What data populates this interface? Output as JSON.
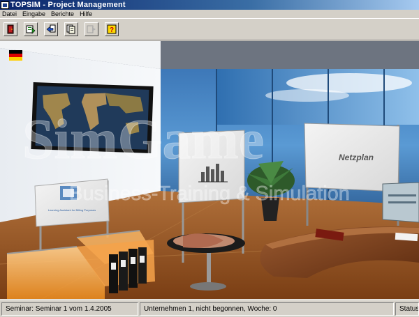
{
  "window": {
    "title": "TOPSIM - Project Management"
  },
  "menu": [
    {
      "label": "Datei"
    },
    {
      "label": "Eingabe"
    },
    {
      "label": "Berichte"
    },
    {
      "label": "Hilfe"
    }
  ],
  "toolbar": [
    {
      "icon": "exit-door-icon"
    },
    {
      "icon": "input-dialog-icon"
    },
    {
      "icon": "arrow-transfer-icon"
    },
    {
      "icon": "report-pages-icon"
    },
    {
      "icon": "disabled-forward-icon"
    },
    {
      "icon": "help-icon"
    }
  ],
  "scene": {
    "flag": "german-flag-icon",
    "watermark_line1": "SimGame",
    "watermark_line2": "Business-Training & Simulation",
    "board_left_label": "Learning Assistant for Billing Purposes",
    "board_right_label": "Netzplan"
  },
  "colors": {
    "title_start": "#0a246a",
    "title_end": "#a6caf0",
    "chrome": "#d4d0c8",
    "floor": "#8a4a1c",
    "cabinet": "#f0a040"
  },
  "status": {
    "seminar": "Seminar: Seminar 1  vom   1.4.2005",
    "company": "Unternehmen 1, nicht begonnen, Woche: 0",
    "state": "Status"
  }
}
